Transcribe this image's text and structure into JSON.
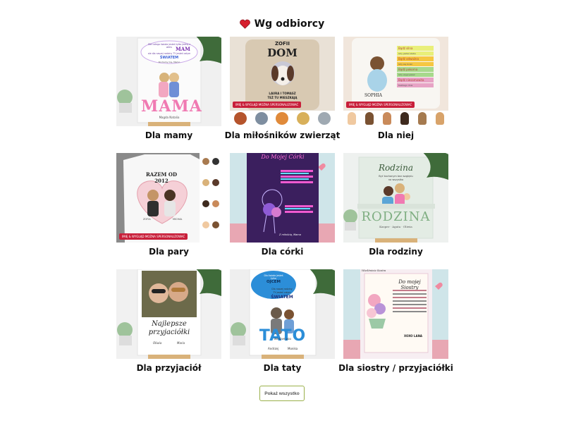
{
  "header": {
    "title": "Wg odbiorcy",
    "icon": "heart-icon",
    "icon_color": "#d6202e"
  },
  "cards": [
    {
      "label": "Dla mamy",
      "art": {
        "line1": "Dla całego świata jesteś tylko jedną z wielu",
        "line2": "MAM",
        "line3": "ale dla naszej rodziny TY jesteś całym",
        "line4": "ŚWIATEM",
        "sign": "Kochamy Cię, Mamo",
        "big": "MAMA",
        "names": "Magda   Natalia"
      }
    },
    {
      "label": "Dla miłośników zwierząt",
      "art": {
        "top": "ZOFII",
        "big": "DOM",
        "bottom1": "LAURA I TOMASZ",
        "bottom2": "TEŻ TU MIESZKAJĄ",
        "badge": "IMIĘ & WYGLĄD MOŻNA SPERSONALIZOWAĆ"
      }
    },
    {
      "label": "Dla niej",
      "art": {
        "notes": [
          "Bądź silna",
          "Gdy jesteś słaba",
          "Bądź odważna",
          "Gdy się boisz",
          "Bądź pokorna",
          "Gdy wygrywasz",
          "Bądź niesamowita",
          "Każdego dnia"
        ],
        "name": "SOPHIA",
        "badge": "IMIĘ & WYGLĄD MOŻNA SPERSONALIZOWAĆ"
      }
    },
    {
      "label": "Dla pary",
      "art": {
        "top": "RAZEM OD",
        "year": "2012",
        "n1": "ZOFIA",
        "n2": "MICHAŁ",
        "badge": "IMIĘ & WYGLĄD MOŻNA SPERSONALIZOWAĆ"
      }
    },
    {
      "label": "Dla córki",
      "art": {
        "title": "Do Mojej Córki",
        "sign": "Z miłością, Mama"
      }
    },
    {
      "label": "Dla rodziny",
      "art": {
        "script": "Rodzina",
        "sub1": "Być kochanym bez względu",
        "sub2": "na wszystko",
        "big": "RODZINA",
        "names": "Kasper · Agata · Oliwia"
      }
    },
    {
      "label": "Dla przyjaciół",
      "art": {
        "l1": "Najlepsze",
        "l2": "przyjaciółki",
        "n1": "Oliwia",
        "n2": "Maria"
      }
    },
    {
      "label": "Dla taty",
      "art": {
        "t1": "Dla świata jesteś",
        "t2": "tylko",
        "t3": "OJCEM",
        "t4": "Dla naszej rodziny",
        "t5": "TY jesteś całym",
        "t6": "ŚWIATEM",
        "big": "TATO",
        "script": "we love you",
        "n1": "Andrzej",
        "n2": "Monika"
      }
    },
    {
      "label": "Dla siostry / przyjaciółki",
      "art": {
        "corner": "Wiedźminie Siostra",
        "title": "Do mojej Siostry",
        "sign": "XOXO LANA"
      }
    }
  ],
  "show_all": {
    "label": "Pokaż wszystko"
  }
}
